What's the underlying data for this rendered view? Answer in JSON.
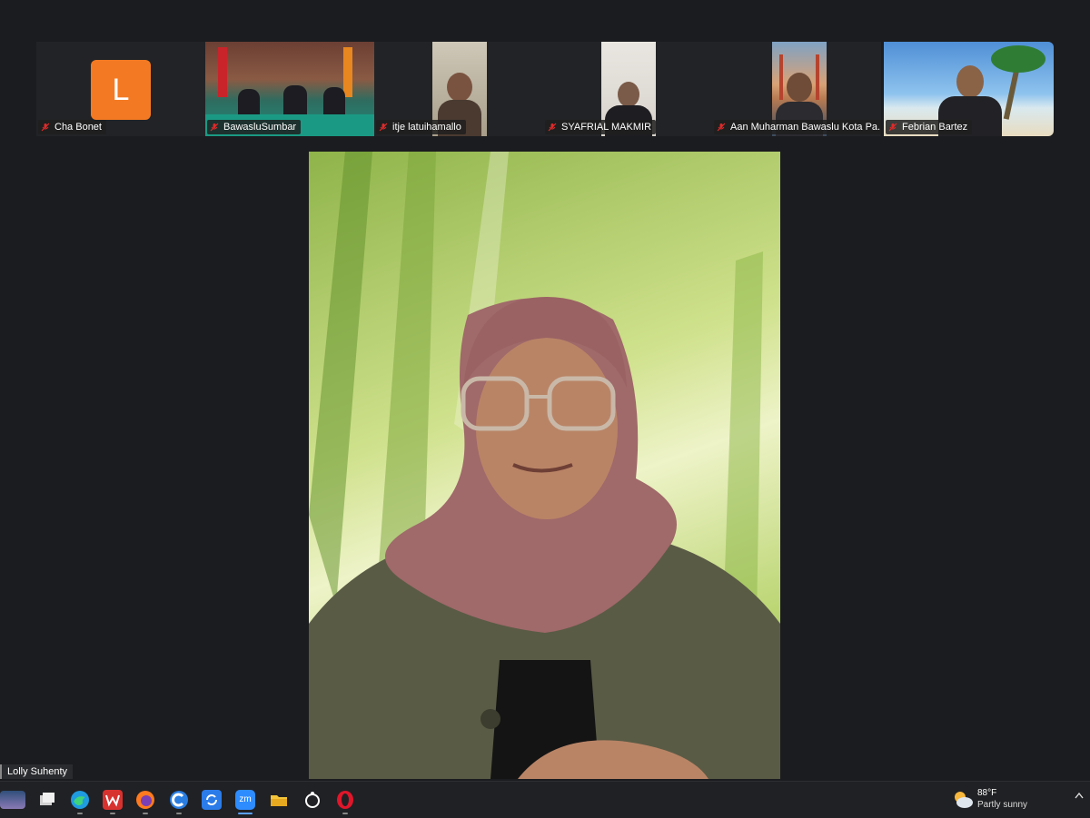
{
  "participants": [
    {
      "name": "Cha Bonet",
      "initial": "L"
    },
    {
      "name": "BawasluSumbar"
    },
    {
      "name": "itje latuihamallo"
    },
    {
      "name": "SYAFRIAL MAKMIR"
    },
    {
      "name": "Aan Muharman Bawaslu Kota Pa..."
    },
    {
      "name": "Febrian Bartez"
    }
  ],
  "active_speaker": {
    "name": "Lolly Suhenty"
  },
  "weather": {
    "temp": "88°F",
    "condition": "Partly sunny"
  },
  "taskbar": {
    "apps": [
      "desktop-thumbnail-icon",
      "task-view-icon",
      "edge-icon",
      "wps-icon",
      "firefox-icon",
      "browser-c-icon",
      "sync-icon",
      "zoom-icon",
      "file-explorer-icon",
      "obs-icon",
      "opera-icon"
    ],
    "zoom_label": "zm"
  },
  "colors": {
    "avatar_bg": "#f37a23",
    "background": "#1b1c1f",
    "mute_red": "#e02b2b"
  }
}
